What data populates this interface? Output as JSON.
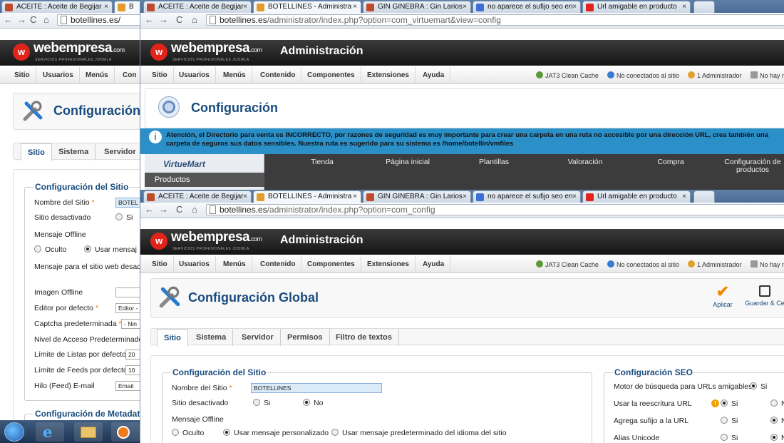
{
  "back_window": {
    "tabs": [
      {
        "label": "ACEITE : Aceite de Begijar",
        "close": "×"
      },
      {
        "label": "B",
        "close": ""
      }
    ],
    "url": {
      "host": "botellines.es/",
      "path": ""
    },
    "logo": {
      "brand": "webempresa",
      "tld": ".com",
      "tagline": "SERVICIOS PROFESIONALES JOOMLA"
    },
    "menu": [
      "Sitio",
      "Usuarios",
      "Menús",
      "Con"
    ],
    "page_title": "Configuración",
    "subtabs": [
      "Sitio",
      "Sistema",
      "Servidor"
    ],
    "section_title": "Configuración del Sitio",
    "fields": {
      "site_name": {
        "label": "Nombre del Sitio",
        "req": "*",
        "value": "BOTEL"
      },
      "offline": {
        "label": "Sitio desactivado",
        "opt": "Si"
      },
      "offline_msg": {
        "label": "Mensaje Offline",
        "opt1": "Oculto",
        "opt2": "Usar mensaj"
      },
      "msg_text": {
        "label": "Mensaje para el sitio web desac"
      },
      "img_offline": {
        "label": "Imagen Offline"
      },
      "editor": {
        "label": "Editor por defecto",
        "req": "*",
        "value": "Editor -"
      },
      "captcha": {
        "label": "Captcha predeterminada",
        "req": "*",
        "value": "- Nin"
      },
      "access": {
        "label": "Nivel de Acceso Predeterminado"
      },
      "list_limit": {
        "label": "Límite de Listas por defecto",
        "value": "20"
      },
      "feed_limit": {
        "label": "Límite de Feeds por defecto",
        "value": "10"
      },
      "feed_email": {
        "label": "Hilo (Feed) E-mail",
        "value": "Email"
      }
    },
    "meta_title": "Configuración de Metadatos"
  },
  "middle_window": {
    "tabs": [
      {
        "label": "ACEITE : Aceite de Begijar",
        "close": "×"
      },
      {
        "label": "BOTELLINES - Administra",
        "close": "×"
      },
      {
        "label": "GIN GINEBRA : Gin Larios",
        "close": "×"
      },
      {
        "label": "no aparece el sufijo seo en",
        "close": "×"
      },
      {
        "label": "Url amigable en producto",
        "close": "×"
      }
    ],
    "url": {
      "host": "botellines.es",
      "path": "/administrator/index.php?option=com_virtuemart&view=config"
    },
    "logo": {
      "brand": "webempresa",
      "tld": ".com",
      "tagline": "SERVICIOS PROFESIONALES JOOMLA"
    },
    "admin_title": "Administración",
    "menu": [
      "Sitio",
      "Usuarios",
      "Menús",
      "Contenido",
      "Componentes",
      "Extensiones",
      "Ayuda"
    ],
    "status": {
      "cache": "JAT3 Clean Cache",
      "visitors": "No conectados al sitio",
      "admins": "1 Administrador",
      "messages": "No hay m"
    },
    "page_title": "Configuración",
    "notice": "Atención, el Directorio para venta es INCORRECTO, por razones de seguridad es muy importante para crear una carpeta en una ruta no accesible por una dirección URL, crea también una carpeta de seguros sus datos sensibles. Nuestra ruta es sugerido para su sistema es /home/botellin/vmfiles",
    "vm_brand": "VirtueMart",
    "vm_side": "Productos",
    "vm_tabs": [
      "Tienda",
      "Página inicial",
      "Plantillas",
      "Valoración",
      "Compra",
      "Configuración de productos"
    ]
  },
  "front_window": {
    "tabs": [
      {
        "label": "ACEITE : Aceite de Begijar",
        "close": "×"
      },
      {
        "label": "BOTELLINES - Administra",
        "close": "×"
      },
      {
        "label": "GIN GINEBRA : Gin Larios",
        "close": "×"
      },
      {
        "label": "no aparece el sufijo seo en",
        "close": "×"
      },
      {
        "label": "Url amigable en producto",
        "close": "×"
      }
    ],
    "url": {
      "host": "botellines.es",
      "path": "/administrator/index.php?option=com_config"
    },
    "logo": {
      "brand": "webempresa",
      "tld": ".com",
      "tagline": "SERVICIOS PROFESIONALES JOOMLA"
    },
    "admin_title": "Administración",
    "menu": [
      "Sitio",
      "Usuarios",
      "Menús",
      "Contenido",
      "Componentes",
      "Extensiones",
      "Ayuda"
    ],
    "status": {
      "cache": "JAT3 Clean Cache",
      "visitors": "No conectados al sitio",
      "admins": "1 Administrador",
      "messages": "No hay m"
    },
    "page_title": "Configuración Global",
    "toolbar": {
      "apply": "Aplicar",
      "save_close": "Guardar & Ce"
    },
    "subtabs": [
      "Sitio",
      "Sistema",
      "Servidor",
      "Permisos",
      "Filtro de textos"
    ],
    "site_section": {
      "title": "Configuración del Sitio",
      "site_name_label": "Nombre del Sitio",
      "site_name_req": "*",
      "site_name_value": "BOTELLINES",
      "offline_label": "Sitio desactivado",
      "offline_yes": "Si",
      "offline_no": "No",
      "offline_msg_label": "Mensaje Offline",
      "msg_opt1": "Oculto",
      "msg_opt2": "Usar mensaje personalizado",
      "msg_opt3": "Usar mensaje predeterminado del idioma del sitio"
    },
    "seo_section": {
      "title": "Configuración SEO",
      "sef_label": "Motor de búsqueda para URLs amigables",
      "sef_yes": "Si",
      "rewrite_label": "Usar la reescritura URL",
      "rewrite_yes": "Si",
      "rewrite_no": "N",
      "suffix_label": "Agrega sufijo a la URL",
      "suffix_yes": "Si",
      "suffix_no": "N",
      "unicode_label": "Alias Unicode",
      "unicode_yes": "Si",
      "unicode_no": "N"
    }
  },
  "colors": {
    "accent": "#1a4b7e",
    "notice": "#2b8fc8",
    "logo_red": "#e2231a",
    "required": "#e87b00"
  }
}
